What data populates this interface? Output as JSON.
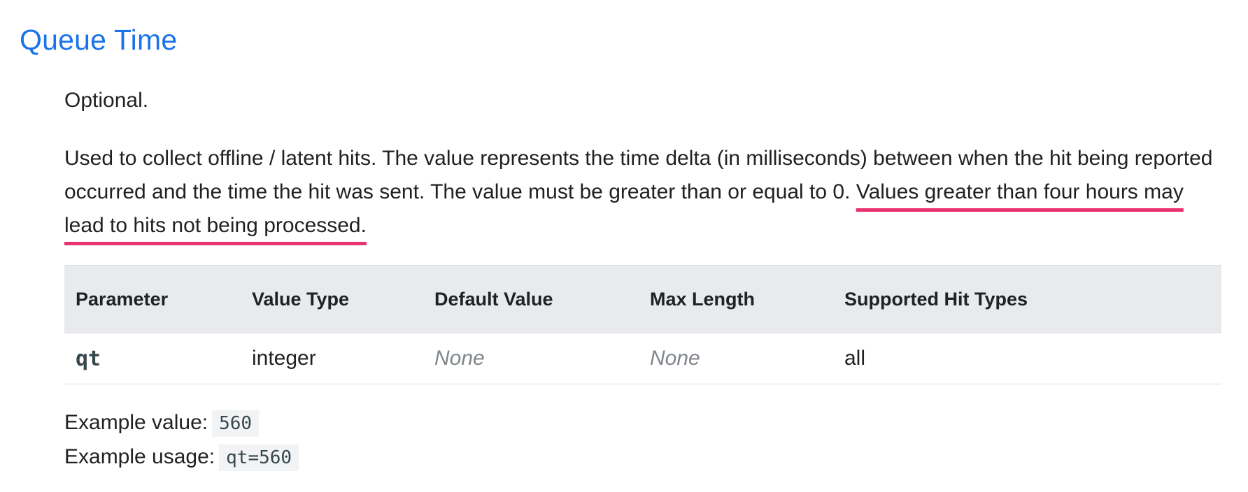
{
  "title": "Queue Time",
  "optional": "Optional.",
  "description_main": "Used to collect offline / latent hits. The value represents the time delta (in milliseconds) between when the hit being reported occurred and the time the hit was sent. The value must be greater than or equal to 0. ",
  "description_highlight": "Values greater than four hours may lead to hits not being processed.",
  "highlight_color": "#e8336d",
  "title_color": "#1a73e8",
  "table": {
    "headers": [
      "Parameter",
      "Value Type",
      "Default Value",
      "Max Length",
      "Supported Hit Types"
    ],
    "row": [
      "qt",
      "integer",
      "None",
      "None",
      "all"
    ]
  },
  "example_value_label": "Example value:",
  "example_value": "560",
  "example_usage_label": "Example usage:",
  "example_usage": "qt=560"
}
